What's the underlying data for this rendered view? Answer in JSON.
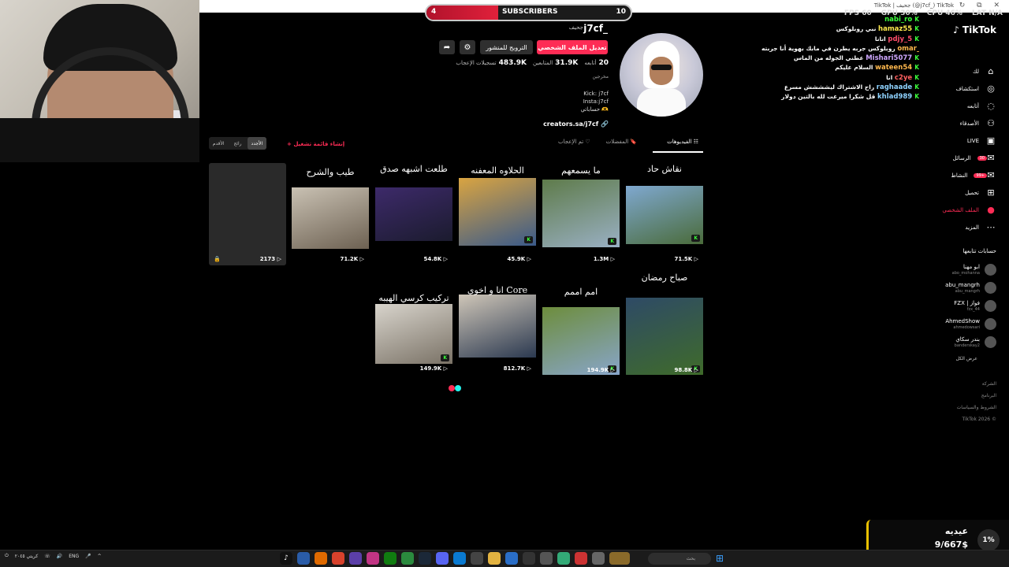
{
  "browser": {
    "tab_title": "TikTok | جحيف (@j7cf_) TikTok",
    "window_icons": "↻ ⧉ ✕"
  },
  "subs_bar": {
    "start": "4",
    "label": "SUBSCRIBERS",
    "end": "10",
    "progress": 0.35
  },
  "stats": [
    "FPS 60",
    "GPU 30%",
    "CPU 46%",
    "LAT N/A"
  ],
  "profile": {
    "username": "j7cf_",
    "display_name": "جحيف",
    "edit_label": "تعديل الملف الشخصي",
    "promote_label": "الترويج للمنشور",
    "gear_icon": "⚙",
    "share_icon": "➦",
    "stats": [
      {
        "value": "20",
        "label": "أتابعه"
      },
      {
        "value": "31.9K",
        "label": "المتابعين"
      },
      {
        "value": "483.9K",
        "label": "تسجيلات الإعجاب"
      }
    ],
    "bio_title": "مخرجين",
    "bio_lines": [
      "Kick: j7cf",
      "Insta:j7cf",
      "حساباتي 🫶"
    ],
    "link": "creators.sa/j7cf 🔗"
  },
  "tabs": [
    {
      "label": "☷ الفيديوهات",
      "active": true
    },
    {
      "label": "🔖 المفضلات",
      "active": false
    },
    {
      "label": "♡ تم الإعجاب",
      "active": false
    }
  ],
  "sort": [
    {
      "label": "الأجدد",
      "active": true
    },
    {
      "label": "رائج",
      "active": false
    },
    {
      "label": "الأقدم",
      "active": false
    }
  ],
  "create_playlist": "+ إنشاء قائمة تشغيل",
  "videos": [
    {
      "caption": "",
      "views": "2173 ▷",
      "colors": [
        "#2a2a2a",
        "#2a2a2a"
      ],
      "locked": true
    },
    {
      "caption": "طيب والشرح",
      "views": "71.2K ▷",
      "colors": [
        "#c9c1b3",
        "#6d6152"
      ]
    },
    {
      "caption": "طلعت اشبهه صدق",
      "views": "54.8K ▷",
      "colors": [
        "#3d2a6a",
        "#1b1b2e"
      ]
    },
    {
      "caption": "الحلاوه المعفنه",
      "views": "45.9K ▷",
      "colors": [
        "#d9a441",
        "#3a5a8a"
      ]
    },
    {
      "caption": "ما يسمعهم",
      "views": "1.3M ▷",
      "colors": [
        "#5e7b4a",
        "#9ab0c4"
      ]
    },
    {
      "caption": "نقاش حاد",
      "views": "71.5K ▷",
      "colors": [
        "#7fa8d0",
        "#4a6b3a"
      ]
    },
    {
      "caption": "تركيب كرسي الهيبه",
      "views": "149.9K ▷",
      "colors": [
        "#d8d4cc",
        "#7a7266"
      ]
    },
    {
      "caption": "انا و اخوي Core",
      "views": "812.7K ▷",
      "colors": [
        "#cfc6b8",
        "#2b3950"
      ]
    },
    {
      "caption": "امم اممم",
      "views": "194.9K ▷",
      "colors": [
        "#6d8d3c",
        "#88a5c9"
      ]
    },
    {
      "caption": "صباح رمضان",
      "views": "98.8K ▷",
      "colors": [
        "#2e4a66",
        "#3f6b2a"
      ]
    }
  ],
  "chat": [
    {
      "user": "nabi_ro",
      "msg": "",
      "color": "#3cff3c"
    },
    {
      "user": "hamaz55",
      "msg": "نبي روبلوكس",
      "color": "#ffe94d"
    },
    {
      "user": "pdjy_5",
      "msg": "انانا",
      "color": "#ff4d6a"
    },
    {
      "user": "omar_92777",
      "msg": "روبلوكس جربه يطرن في مابك بهوية أنا جربته",
      "color": "#ffb84d"
    },
    {
      "user": "Mishari5077",
      "msg": "عطني الجوله من الماس",
      "color": "#cfa8ff"
    },
    {
      "user": "wateen54",
      "msg": "السلام عليكم",
      "color": "#ffb84d"
    },
    {
      "user": "c2ye",
      "msg": "انا",
      "color": "#ff6060"
    },
    {
      "user": "raghaade",
      "msg": "راح الاشتراك ليشششش مسرع",
      "color": "#8fd3ff"
    },
    {
      "user": "khlad989",
      "msg": "قل شكرا ميرعت لله بالتين دولار",
      "color": "#8fd3ff"
    }
  ],
  "tiktok_logo": "♪ TikTok",
  "sidebar": [
    {
      "label": "لك",
      "icon": "⌂",
      "active": false
    },
    {
      "label": "استكشاف",
      "icon": "◎",
      "active": false
    },
    {
      "label": "أتابعه",
      "icon": "◌",
      "active": false
    },
    {
      "label": "الأصدقاء",
      "icon": "⚇",
      "active": false
    },
    {
      "label": "LIVE",
      "icon": "▣",
      "active": false
    },
    {
      "label": "الرسائل",
      "icon": "✉",
      "active": false,
      "badge": "30"
    },
    {
      "label": "النشاط",
      "icon": "✉",
      "active": false,
      "badge": "99+"
    },
    {
      "label": "تحميل",
      "icon": "⊞",
      "active": false
    },
    {
      "label": "الملف الشخصي",
      "icon": "●",
      "active": true
    },
    {
      "label": "المزيد",
      "icon": "⋯",
      "active": false
    }
  ],
  "following_title": "حسابات تتابعها",
  "following": [
    {
      "name": "ابو مهنا",
      "handle": "abo_mohanna"
    },
    {
      "name": "abu_mangrh",
      "handle": "abu_mangrh"
    },
    {
      "name": "FZX | فواز",
      "handle": "fzx_44"
    },
    {
      "name": "AhmedShow",
      "handle": "ahmedowsari"
    },
    {
      "name": "بندر سكاي",
      "handle": "banderskay2"
    }
  ],
  "see_all": "عرض الكل",
  "footer": [
    "الشركة",
    "البرنامج",
    "الشروط والسياسات",
    "TikTok 2026 ©"
  ],
  "donation": {
    "name": "عيديه",
    "amount": "9/667$",
    "pct": "1%"
  },
  "taskbar": {
    "left": [
      "⏻",
      "كريتي ٢٠٤٥",
      "☏",
      "🔊",
      "ENG",
      "🎤",
      "^"
    ],
    "search": "بحث",
    "start_icon": "⊞"
  },
  "colors": {
    "accent": "#fe2c55",
    "kick": "#3cff3c"
  }
}
